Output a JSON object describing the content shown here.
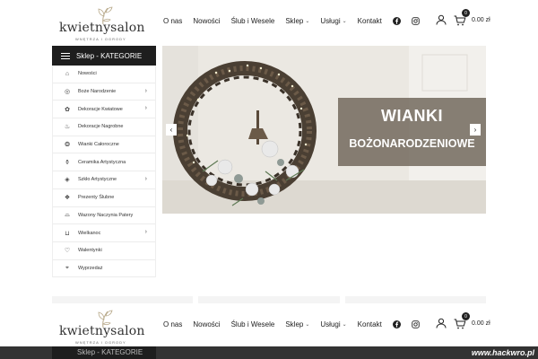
{
  "logo": {
    "name": "kwietnysalon",
    "tagline": "WNĘTRZA I OGRODY"
  },
  "nav": {
    "items": [
      {
        "label": "O nas",
        "caret": false
      },
      {
        "label": "Nowości",
        "caret": false
      },
      {
        "label": "Ślub i Wesele",
        "caret": false
      },
      {
        "label": "Sklep",
        "caret": true
      },
      {
        "label": "Usługi",
        "caret": true
      },
      {
        "label": "Kontakt",
        "caret": false
      }
    ],
    "social": [
      "facebook-icon",
      "instagram-icon"
    ]
  },
  "cart": {
    "count": "0",
    "total": "0.00 zł"
  },
  "sidebar": {
    "title": "Sklep - KATEGORIE",
    "items": [
      {
        "label": "Nowości",
        "icon": "house-icon",
        "has_sub": false
      },
      {
        "label": "Boże Narodzenie",
        "icon": "ornament-icon",
        "has_sub": true
      },
      {
        "label": "Dekoracje Kwiatowe",
        "icon": "flower-icon",
        "has_sub": true
      },
      {
        "label": "Dekoracje Nagrobne",
        "icon": "candle-icon",
        "has_sub": false
      },
      {
        "label": "Wianki Całoroczne",
        "icon": "wreath-icon",
        "has_sub": false
      },
      {
        "label": "Ceramika Artystyczna",
        "icon": "vase-icon",
        "has_sub": false
      },
      {
        "label": "Szkło Artystyczne",
        "icon": "glass-icon",
        "has_sub": true
      },
      {
        "label": "Prezenty Ślubne",
        "icon": "gift-icon",
        "has_sub": false
      },
      {
        "label": "Wazony Naczynia Patery",
        "icon": "pot-icon",
        "has_sub": false
      },
      {
        "label": "Wielkanoc",
        "icon": "basket-icon",
        "has_sub": true
      },
      {
        "label": "Walentynki",
        "icon": "heart-icon",
        "has_sub": false
      },
      {
        "label": "Wyprzedaż",
        "icon": "tag-icon",
        "has_sub": false
      }
    ]
  },
  "slider": {
    "headline": "WIANKI",
    "subline": "BOŻONARODZENIOWE",
    "prev": "‹",
    "next": "›"
  },
  "watermark": "www.hackwro.pl",
  "colors": {
    "dark": "#1e1e1e",
    "banner": "#6e6458",
    "bg": "#ffffff"
  }
}
